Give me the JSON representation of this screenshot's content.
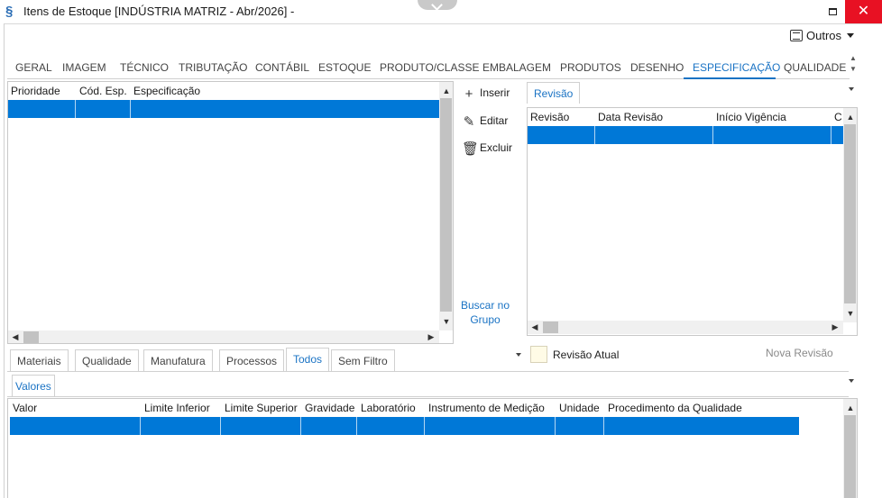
{
  "window": {
    "title": "Itens de Estoque [INDÚSTRIA MATRIZ - Abr/2026]  -",
    "close_glyph": "✕"
  },
  "toolbar": {
    "outros_label": "Outros"
  },
  "main_tabs": [
    "GERAL",
    "IMAGEM",
    "TÉCNICO",
    "TRIBUTAÇÃO",
    "CONTÁBIL",
    "ESTOQUE",
    "PRODUTO/CLASSE",
    "EMBALAGEM",
    "PRODUTOS",
    "DESENHO",
    "ESPECIFICAÇÃO",
    "QUALIDADE"
  ],
  "active_main_tab": "ESPECIFICAÇÃO",
  "spec_grid": {
    "columns": [
      "Prioridade",
      "Cód. Esp.",
      "Especificação"
    ]
  },
  "actions": {
    "insert": "Inserir",
    "edit": "Editar",
    "delete": "Excluir",
    "search_group": "Buscar no Grupo"
  },
  "revision_panel": {
    "tab_label": "Revisão",
    "columns": [
      "Revisão",
      "Data Revisão",
      "Início Vigência",
      "C"
    ],
    "current_revision_label": "Revisão Atual",
    "new_revision_label": "Nova Revisão"
  },
  "sub_tabs": [
    "Materiais",
    "Qualidade",
    "Manufatura",
    "Processos",
    "Todos",
    "Sem Filtro"
  ],
  "active_sub_tab": "Todos",
  "values_tab_label": "Valores",
  "values_grid": {
    "columns": [
      "Valor",
      "Limite Inferior",
      "Limite Superior",
      "Gravidade",
      "Laboratório",
      "Instrumento de Medição",
      "Unidade",
      "Procedimento da Qualidade"
    ]
  },
  "colors": {
    "accent": "#1a73c4",
    "selection": "#0078d7",
    "close_button": "#e81123",
    "checkbox_fill": "#fffbe6"
  },
  "icons": {
    "app": "s-logo-icon",
    "outros": "list-icon",
    "insert": "plus-icon",
    "edit": "edit-icon",
    "delete": "trash-icon"
  }
}
